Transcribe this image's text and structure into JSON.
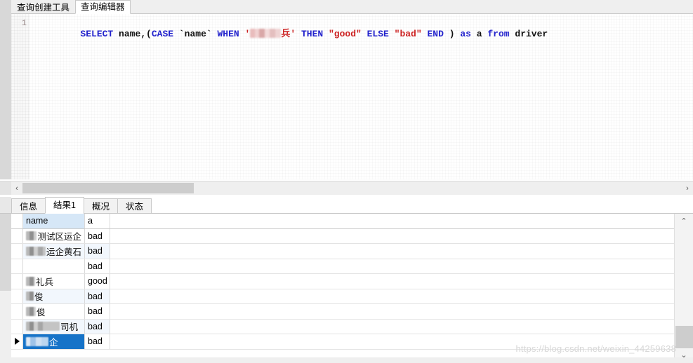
{
  "window": {
    "top_tabs": [
      {
        "label": "查询创建工具",
        "active": false
      },
      {
        "label": "查询编辑器",
        "active": true
      }
    ]
  },
  "editor": {
    "line_number": "1",
    "sql_tokens": [
      {
        "text": "SELECT",
        "kind": "keyword"
      },
      {
        "text": " ",
        "kind": "plain"
      },
      {
        "text": "name",
        "kind": "identifier"
      },
      {
        "text": ",(",
        "kind": "punct"
      },
      {
        "text": "CASE",
        "kind": "keyword"
      },
      {
        "text": " ",
        "kind": "plain"
      },
      {
        "text": "`name`",
        "kind": "identifier"
      },
      {
        "text": " ",
        "kind": "plain"
      },
      {
        "text": "WHEN",
        "kind": "keyword"
      },
      {
        "text": " ",
        "kind": "plain"
      },
      {
        "text": "'",
        "kind": "string"
      },
      {
        "text": "[redacted]",
        "kind": "redacted"
      },
      {
        "text": "兵'",
        "kind": "string"
      },
      {
        "text": " ",
        "kind": "plain"
      },
      {
        "text": "THEN",
        "kind": "keyword"
      },
      {
        "text": " ",
        "kind": "plain"
      },
      {
        "text": "\"good\"",
        "kind": "string"
      },
      {
        "text": " ",
        "kind": "plain"
      },
      {
        "text": "ELSE",
        "kind": "keyword"
      },
      {
        "text": " ",
        "kind": "plain"
      },
      {
        "text": "\"bad\"",
        "kind": "string"
      },
      {
        "text": " ",
        "kind": "plain"
      },
      {
        "text": "END",
        "kind": "keyword"
      },
      {
        "text": " ) ",
        "kind": "punct"
      },
      {
        "text": "as",
        "kind": "keyword"
      },
      {
        "text": " ",
        "kind": "plain"
      },
      {
        "text": "a",
        "kind": "identifier"
      },
      {
        "text": " ",
        "kind": "plain"
      },
      {
        "text": "from",
        "kind": "keyword"
      },
      {
        "text": " ",
        "kind": "plain"
      },
      {
        "text": "driver",
        "kind": "identifier"
      }
    ],
    "sql_plain": "SELECT name,(CASE `name` WHEN '▒▒▒兵' THEN \"good\" ELSE \"bad\" END ) as a from driver"
  },
  "result_tabs": [
    {
      "label": "信息",
      "active": false
    },
    {
      "label": "结果1",
      "active": true
    },
    {
      "label": "概况",
      "active": false
    },
    {
      "label": "状态",
      "active": false
    }
  ],
  "grid": {
    "columns": [
      "name",
      "a"
    ],
    "selected_column": "name",
    "rows": [
      {
        "name_blob": "wide",
        "name_text": "测试区运企",
        "a": "bad",
        "selected": false,
        "marker": false
      },
      {
        "name_blob": "wide",
        "name_text": "运企黄石",
        "a": "bad",
        "selected": false,
        "marker": false
      },
      {
        "name_blob": "none",
        "name_text": "",
        "a": "bad",
        "selected": false,
        "marker": false
      },
      {
        "name_blob": "small",
        "name_text": "礼兵",
        "a": "good",
        "selected": false,
        "marker": false
      },
      {
        "name_blob": "small",
        "name_text": "俊",
        "a": "bad",
        "selected": false,
        "marker": false
      },
      {
        "name_blob": "small",
        "name_text": "俊",
        "a": "bad",
        "selected": false,
        "marker": false
      },
      {
        "name_blob": "wide",
        "name_text": "司机",
        "a": "bad",
        "selected": false,
        "marker": false
      },
      {
        "name_blob": "sel",
        "name_text": "企",
        "a": "bad",
        "selected": true,
        "marker": true
      }
    ]
  },
  "scrollbars": {
    "h_left_arrow": "‹",
    "h_right_arrow": "›",
    "v_up_arrow": "⌃",
    "v_down_arrow": "⌄"
  },
  "watermark": "https://blog.csdn.net/weixin_44259638",
  "colors": {
    "keyword": "#2222cc",
    "string": "#cc2222",
    "identifier": "#111111",
    "selection": "#1673c8",
    "header_selected": "#d6e7f7"
  }
}
